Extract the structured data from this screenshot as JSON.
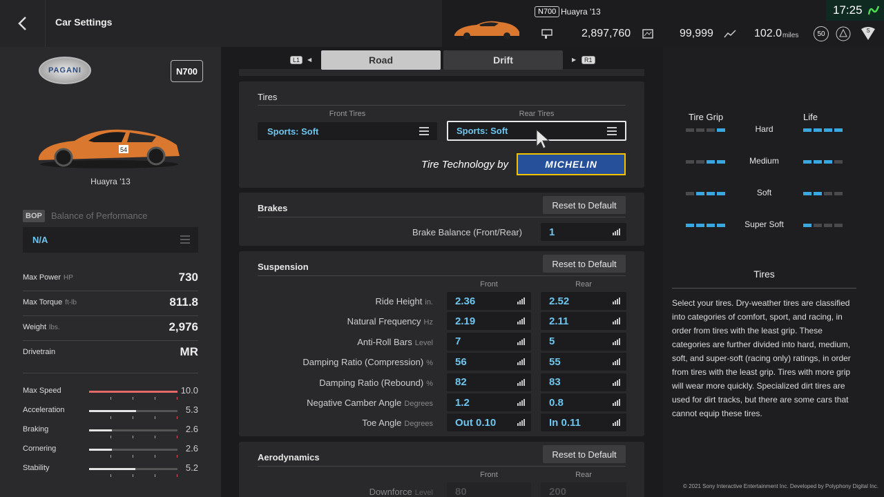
{
  "header": {
    "title": "Car Settings",
    "time": "17:25"
  },
  "car": {
    "class_badge": "N700",
    "name": "Huayra '13",
    "credits": "2,897,760",
    "mileage_points": "99,999",
    "odometer": "102.0",
    "odometer_unit": "miles",
    "level": "50"
  },
  "sidebar": {
    "brand": "PAGANI",
    "class_badge": "N700",
    "car_name": "Huayra '13",
    "bop_tag": "BOP",
    "bop_label": "Balance of Performance",
    "bop_value": "N/A",
    "specs": [
      {
        "label": "Max Power",
        "unit": "HP",
        "value": "730"
      },
      {
        "label": "Max Torque",
        "unit": "ft-lb",
        "value": "811.8"
      },
      {
        "label": "Weight",
        "unit": "lbs.",
        "value": "2,976"
      },
      {
        "label": "Drivetrain",
        "unit": "",
        "value": "MR"
      }
    ],
    "performance": [
      {
        "label": "Max Speed",
        "value": "10.0",
        "fraction": 1.0
      },
      {
        "label": "Acceleration",
        "value": "5.3",
        "fraction": 0.53
      },
      {
        "label": "Braking",
        "value": "2.6",
        "fraction": 0.26
      },
      {
        "label": "Cornering",
        "value": "2.6",
        "fraction": 0.26
      },
      {
        "label": "Stability",
        "value": "5.2",
        "fraction": 0.52
      }
    ]
  },
  "tabs": {
    "l1": "L1",
    "r1": "R1",
    "road": "Road",
    "drift": "Drift"
  },
  "tires": {
    "title": "Tires",
    "front_header": "Front Tires",
    "rear_header": "Rear Tires",
    "front_value": "Sports: Soft",
    "rear_value": "Sports: Soft",
    "tech_label": "Tire Technology by",
    "brand": "MICHELIN"
  },
  "brakes": {
    "title": "Brakes",
    "reset": "Reset to Default",
    "balance_label": "Brake Balance (Front/Rear)",
    "balance_value": "1"
  },
  "suspension": {
    "title": "Suspension",
    "reset": "Reset to Default",
    "front": "Front",
    "rear": "Rear",
    "rows": [
      {
        "label": "Ride Height",
        "unit": "in.",
        "front": "2.36",
        "rear": "2.52"
      },
      {
        "label": "Natural Frequency",
        "unit": "Hz",
        "front": "2.19",
        "rear": "2.11"
      },
      {
        "label": "Anti-Roll Bars",
        "unit": "Level",
        "front": "7",
        "rear": "5"
      },
      {
        "label": "Damping Ratio (Compression)",
        "unit": "%",
        "front": "56",
        "rear": "55"
      },
      {
        "label": "Damping Ratio (Rebound)",
        "unit": "%",
        "front": "82",
        "rear": "83"
      },
      {
        "label": "Negative Camber Angle",
        "unit": "Degrees",
        "front": "1.2",
        "rear": "0.8"
      },
      {
        "label": "Toe Angle",
        "unit": "Degrees",
        "front": "Out 0.10",
        "rear": "In 0.11"
      }
    ]
  },
  "aero": {
    "title": "Aerodynamics",
    "reset": "Reset to Default",
    "front": "Front",
    "rear": "Rear",
    "row_label": "Downforce",
    "row_unit": "Level",
    "front_value": "80",
    "rear_value": "200"
  },
  "tire_info": {
    "grip_header": "Tire Grip",
    "life_header": "Life",
    "compounds": [
      {
        "name": "Hard",
        "grip": 1,
        "life": 4
      },
      {
        "name": "Medium",
        "grip": 2,
        "life": 3
      },
      {
        "name": "Soft",
        "grip": 3,
        "life": 2
      },
      {
        "name": "Super Soft",
        "grip": 4,
        "life": 1
      }
    ],
    "title": "Tires",
    "description": "Select your tires. Dry-weather tires are classified into categories of comfort, sport, and racing, in order from tires with the least grip. These categories are further divided into hard, medium, soft, and super-soft (racing only) ratings, in order from tires with the least grip. Tires with more grip will wear more quickly. Specialized dirt tires are used for dirt tracks, but there are some cars that cannot equip these tires."
  },
  "footer": {
    "copyright": "© 2021 Sony Interactive Entertainment Inc. Developed by Polyphony Digital Inc."
  },
  "colors": {
    "accent": "#3aa8e0",
    "value": "#6ec6f0",
    "car_orange": "#d9782e"
  }
}
